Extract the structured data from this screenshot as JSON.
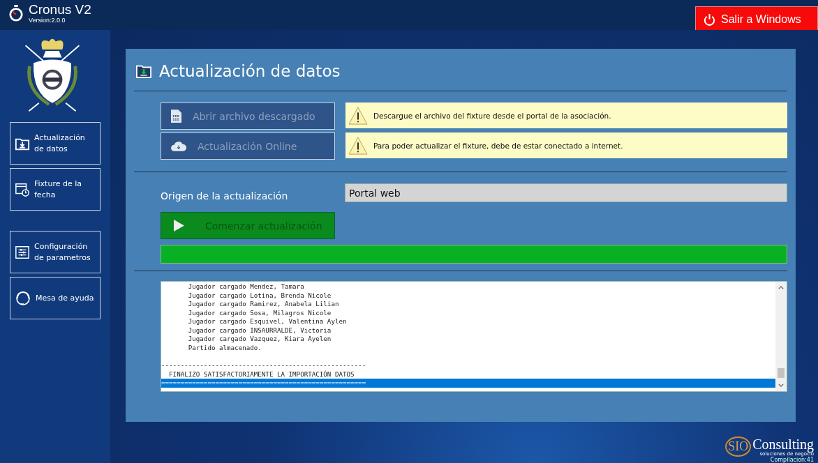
{
  "app": {
    "title": "Cronus V2",
    "version": "Version:2.0.0",
    "exit_button": "Salir a Windows"
  },
  "sidebar": {
    "items": [
      {
        "label": "Actualización de datos",
        "kind": "update"
      },
      {
        "label": "Fixture de la fecha",
        "kind": "calendar"
      },
      {
        "label": "Configuración de parametros",
        "kind": "settings"
      },
      {
        "label": "Mesa de ayuda",
        "kind": "help"
      }
    ]
  },
  "panel": {
    "title": "Actualización de datos",
    "actions": [
      {
        "label": "Abrir archivo descargado",
        "kind": "file",
        "notice": "Descargue el archivo del fixture desde el portal de la asociación."
      },
      {
        "label": "Actualización Online",
        "kind": "cloud",
        "notice": "Para poder actualizar el fixture, debe de estar conectado a internet."
      }
    ],
    "origin_label": "Origen de la actualización",
    "origin_value": "Portal web",
    "start_button": "Comenzar actualización",
    "progress": {
      "level": 1
    },
    "log": [
      {
        "text": "       Jugador cargado Mendez, Tamara",
        "selected": false
      },
      {
        "text": "       Jugador cargado Lotina, Brenda Nicole",
        "selected": false
      },
      {
        "text": "       Jugador cargado Ramirez, Anabela Lilian",
        "selected": false
      },
      {
        "text": "       Jugador cargado Sosa, Milagros Nicole",
        "selected": false
      },
      {
        "text": "       Jugador cargado Esquivel, Valentina Aylen",
        "selected": false
      },
      {
        "text": "       Jugador cargado INSAURRALDE, Victoria",
        "selected": false
      },
      {
        "text": "       Jugador cargado Vazquez, Kiara Ayelen",
        "selected": false
      },
      {
        "text": "       Partido almacenado.",
        "selected": false,
        "gap_after": true
      },
      {
        "text": "-----------------------------------------------------",
        "selected": false
      },
      {
        "text": "  FINALIZO SATISFACTORIAMENTE LA IMPORTACIÓN DATOS",
        "selected": false
      },
      {
        "text": "=====================================================",
        "selected": true
      }
    ]
  },
  "footer": {
    "brand_mark": "SIO",
    "brand_name": "Consulting",
    "tagline": "soluciones de negocio",
    "build": "Compilacion:41"
  }
}
